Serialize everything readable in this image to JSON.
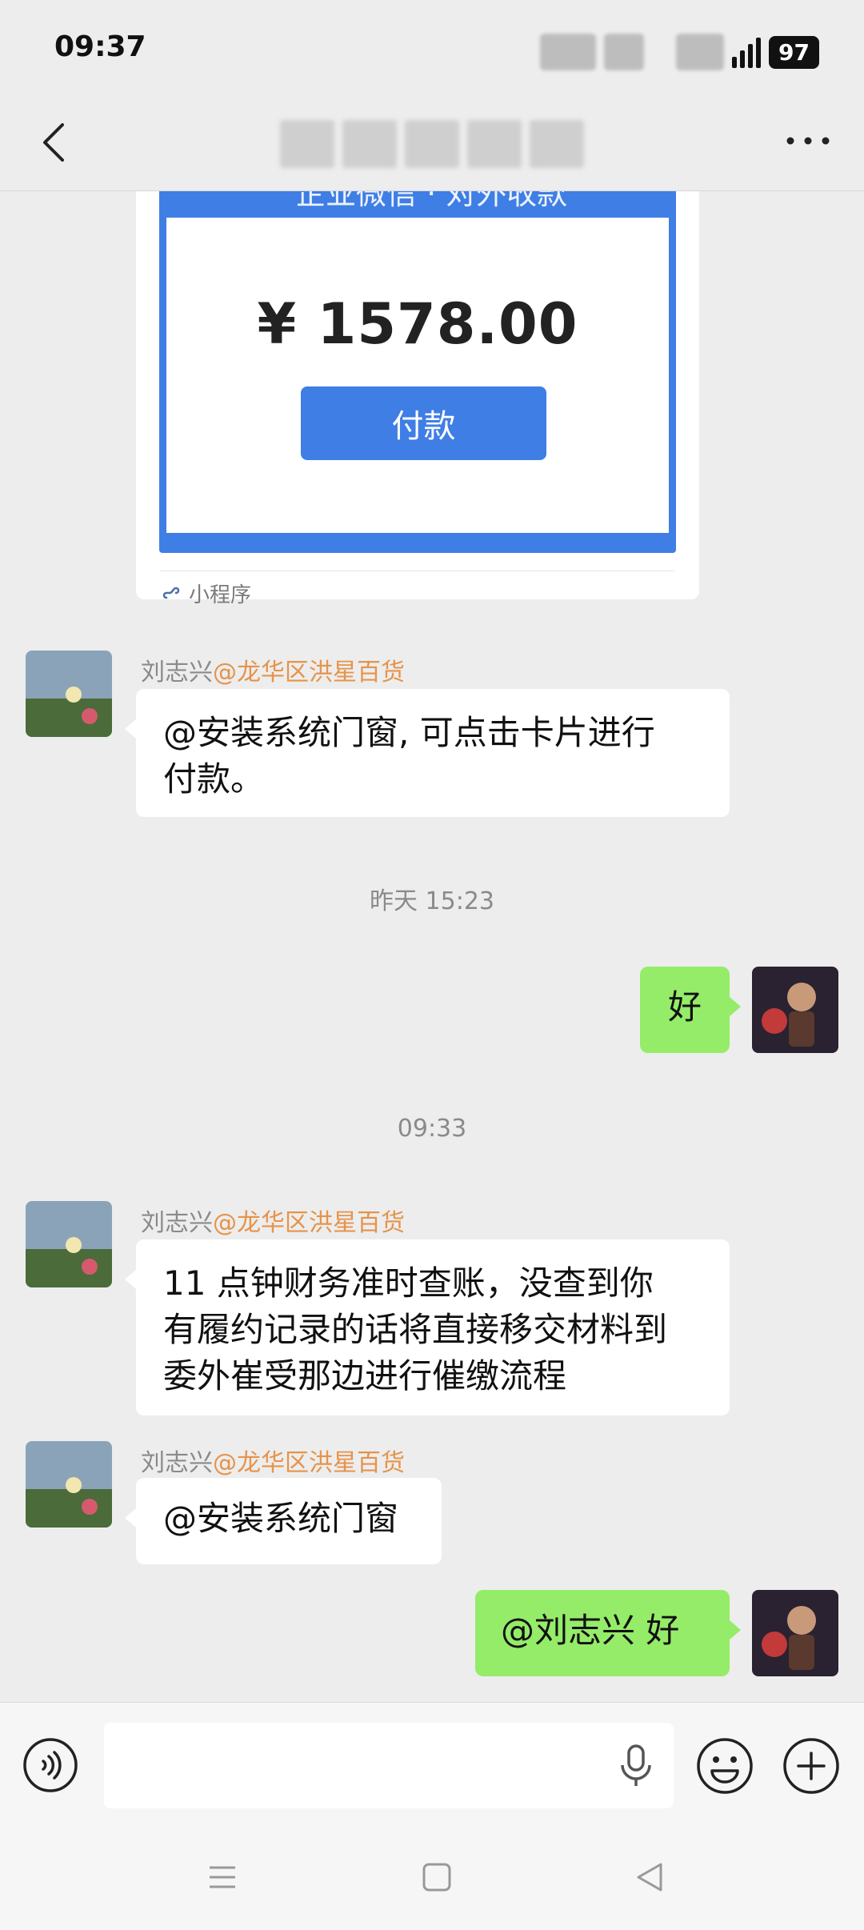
{
  "status_bar": {
    "time": "09:37",
    "battery": "97"
  },
  "nav": {
    "title": ""
  },
  "card": {
    "banner_text": "企业微信 · 对外收款",
    "amount": "¥ 1578.00",
    "pay_button": "付款",
    "footer_label": "小程序"
  },
  "messages": [
    {
      "sender": "刘志兴",
      "group": "@龙华区洪星百货",
      "text_lines": [
        "@安装系统门窗, 可点击卡片进行",
        "付款。"
      ]
    },
    {
      "self_text": "好"
    },
    {
      "sender": "刘志兴",
      "group": "@龙华区洪星百货",
      "text_lines": [
        "11 点钟财务准时查账，没查到你",
        "有履约记录的话将直接移交材料到",
        "委外崔受那边进行催缴流程"
      ]
    },
    {
      "sender": "刘志兴",
      "group": "@龙华区洪星百货",
      "text_lines": [
        "@安装系统门窗"
      ]
    },
    {
      "self_text": "@刘志兴  好"
    }
  ],
  "timestamps": [
    "昨天 15:23",
    "09:33"
  ],
  "input": {
    "value": "",
    "placeholder": ""
  },
  "colors": {
    "self_bubble": "#95ec69",
    "accent": "#3f7ee5",
    "group_name": "#e6934a"
  }
}
